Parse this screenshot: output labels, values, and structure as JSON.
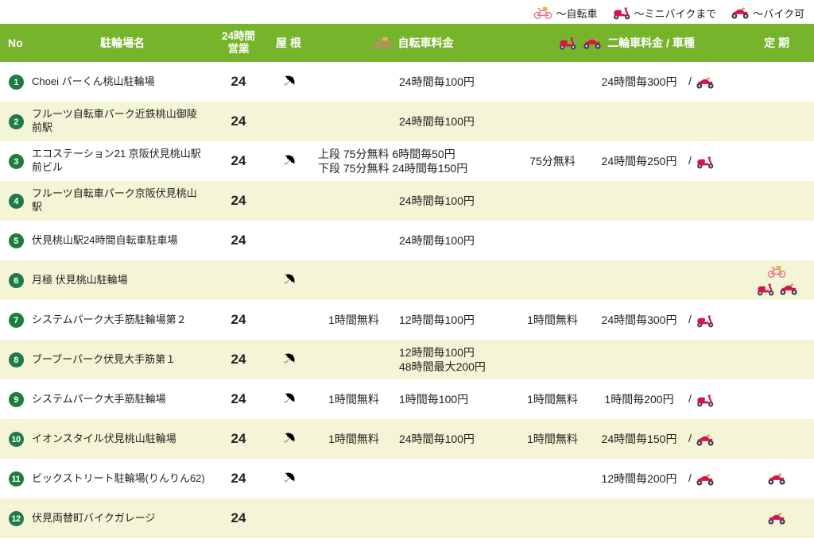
{
  "legend": {
    "items": [
      {
        "icon": "bicycle-icon",
        "label": "～自転車"
      },
      {
        "icon": "scooter-icon",
        "label": "～ミニバイクまで"
      },
      {
        "icon": "motorcycle-icon",
        "label": "～バイク可"
      }
    ]
  },
  "header": {
    "no": "No",
    "name": "駐輪場名",
    "open24_line1": "24時間",
    "open24_line2": "営業",
    "roof": "屋 根",
    "bicycle_fee": "自転車料金",
    "bicycle_fee_icon": "bicycle-icon",
    "moto_fee": "二輪車料金 / 車種",
    "moto_icons": [
      "scooter-icon",
      "motorcycle-icon"
    ],
    "teiki": "定 期"
  },
  "icons": {
    "umbrella_glyph": "☂"
  },
  "colors": {
    "header_bg": "#76b52b",
    "header_text": "#ffffff",
    "row_alt_bg": "#f4f4d6",
    "row_bg": "#ffffff",
    "badge_bg": "#1e7b46",
    "badge_text": "#ffffff",
    "vehicle_red": "#d5164e",
    "bicycle_pink": "#e2758d",
    "basket_yellow": "#efb73e",
    "wheel_dark": "#3c3c55",
    "accent_orange": "#ef8b2e",
    "text": "#222222"
  },
  "rows": [
    {
      "no": "1",
      "name": "Choei パーくん桃山駐輪場",
      "open24": "24",
      "roof": true,
      "bike_free": "",
      "bike_fee_lines": [
        "24時間毎100円"
      ],
      "bike_span_lines": [],
      "moto_free": "",
      "moto_fee": "24時間毎300円",
      "moto_icon": "motorcycle-icon",
      "teiki_icon_lines": []
    },
    {
      "no": "2",
      "name": "フルーツ自転車パーク近鉄桃山御陵前駅",
      "open24": "24",
      "roof": false,
      "bike_free": "",
      "bike_fee_lines": [
        "24時間毎100円"
      ],
      "bike_span_lines": [],
      "moto_free": "",
      "moto_fee": "",
      "moto_icon": null,
      "teiki_icon_lines": []
    },
    {
      "no": "3",
      "name": "エコステーション21 京阪伏見桃山駅前ビル",
      "open24": "24",
      "roof": true,
      "bike_free": "",
      "bike_fee_lines": [],
      "bike_span_lines": [
        "上段 75分無料 6時間毎50円",
        "下段 75分無料 24時間毎150円"
      ],
      "moto_free": "75分無料",
      "moto_fee": "24時間毎250円",
      "moto_icon": "scooter-icon",
      "teiki_icon_lines": []
    },
    {
      "no": "4",
      "name": "フルーツ自転車パーク京阪伏見桃山駅",
      "open24": "24",
      "roof": false,
      "bike_free": "",
      "bike_fee_lines": [
        "24時間毎100円"
      ],
      "bike_span_lines": [],
      "moto_free": "",
      "moto_fee": "",
      "moto_icon": null,
      "teiki_icon_lines": []
    },
    {
      "no": "5",
      "name": "伏見桃山駅24時間自転車駐車場",
      "open24": "24",
      "roof": false,
      "bike_free": "",
      "bike_fee_lines": [
        "24時間毎100円"
      ],
      "bike_span_lines": [],
      "moto_free": "",
      "moto_fee": "",
      "moto_icon": null,
      "teiki_icon_lines": []
    },
    {
      "no": "6",
      "name": "月極 伏見桃山駐輪場",
      "open24": "",
      "roof": true,
      "bike_free": "",
      "bike_fee_lines": [],
      "bike_span_lines": [],
      "moto_free": "",
      "moto_fee": "",
      "moto_icon": null,
      "teiki_icon_lines": [
        [
          "bicycle-icon"
        ],
        [
          "scooter-icon",
          "motorcycle-icon"
        ]
      ]
    },
    {
      "no": "7",
      "name": "システムパーク大手筋駐輪場第２",
      "open24": "24",
      "roof": false,
      "bike_free": "1時間無料",
      "bike_fee_lines": [
        "12時間毎100円"
      ],
      "bike_span_lines": [],
      "moto_free": "1時間無料",
      "moto_fee": "24時間毎300円",
      "moto_icon": "scooter-icon",
      "teiki_icon_lines": []
    },
    {
      "no": "8",
      "name": "ブーブーパーク伏見大手筋第１",
      "open24": "24",
      "roof": true,
      "bike_free": "",
      "bike_fee_lines": [
        "12時間毎100円",
        "48時間最大200円"
      ],
      "bike_span_lines": [],
      "moto_free": "",
      "moto_fee": "",
      "moto_icon": null,
      "teiki_icon_lines": []
    },
    {
      "no": "9",
      "name": "システムパーク大手筋駐輪場",
      "open24": "24",
      "roof": true,
      "bike_free": "1時間無料",
      "bike_fee_lines": [
        "1時間毎100円"
      ],
      "bike_span_lines": [],
      "moto_free": "1時間無料",
      "moto_fee": "1時間毎200円",
      "moto_icon": "scooter-icon",
      "teiki_icon_lines": []
    },
    {
      "no": "10",
      "name": "イオンスタイル伏見桃山駐輪場",
      "open24": "24",
      "roof": true,
      "bike_free": "1時間無料",
      "bike_fee_lines": [
        "24時間毎100円"
      ],
      "bike_span_lines": [],
      "moto_free": "1時間無料",
      "moto_fee": "24時間毎150円",
      "moto_icon": "motorcycle-icon",
      "teiki_icon_lines": []
    },
    {
      "no": "11",
      "name": "ビックストリート駐輪場(りんりん62)",
      "open24": "24",
      "roof": true,
      "bike_free": "",
      "bike_fee_lines": [],
      "bike_span_lines": [],
      "moto_free": "",
      "moto_fee": "12時間毎200円",
      "moto_icon": "motorcycle-icon",
      "teiki_icon_lines": [
        [
          "motorcycle-icon"
        ]
      ]
    },
    {
      "no": "12",
      "name": "伏見両替町バイクガレージ",
      "open24": "24",
      "roof": false,
      "bike_free": "",
      "bike_fee_lines": [],
      "bike_span_lines": [],
      "moto_free": "",
      "moto_fee": "",
      "moto_icon": null,
      "teiki_icon_lines": [
        [
          "motorcycle-icon"
        ]
      ]
    }
  ]
}
